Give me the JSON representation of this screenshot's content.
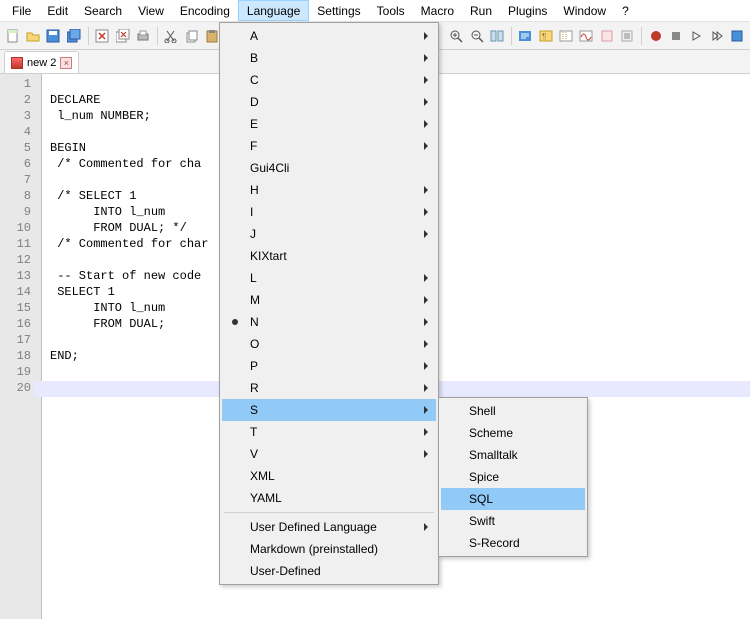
{
  "menubar": {
    "items": [
      "File",
      "Edit",
      "Search",
      "View",
      "Encoding",
      "Language",
      "Settings",
      "Tools",
      "Macro",
      "Run",
      "Plugins",
      "Window",
      "?"
    ],
    "active": "Language"
  },
  "tab": {
    "label": "new 2",
    "close": "×"
  },
  "gutter": {
    "lines": [
      "1",
      "2",
      "3",
      "4",
      "5",
      "6",
      "7",
      "8",
      "9",
      "10",
      "11",
      "12",
      "13",
      "14",
      "15",
      "16",
      "17",
      "18",
      "19",
      "20"
    ]
  },
  "code": {
    "lines": [
      "",
      "DECLARE",
      " l_num NUMBER;",
      "",
      "BEGIN",
      " /* Commented for cha",
      "",
      " /* SELECT 1",
      "      INTO l_num",
      "      FROM DUAL; */",
      " /* Commented for char",
      "",
      " -- Start of new code ",
      " SELECT 1",
      "      INTO l_num",
      "      FROM DUAL;",
      "",
      "END;",
      "",
      ""
    ]
  },
  "langMenu": {
    "groups": [
      {
        "items": [
          {
            "label": "A",
            "sub": true
          },
          {
            "label": "B",
            "sub": true
          },
          {
            "label": "C",
            "sub": true
          },
          {
            "label": "D",
            "sub": true
          },
          {
            "label": "E",
            "sub": true
          },
          {
            "label": "F",
            "sub": true
          },
          {
            "label": "Gui4Cli",
            "sub": false
          },
          {
            "label": "H",
            "sub": true
          },
          {
            "label": "I",
            "sub": true
          },
          {
            "label": "J",
            "sub": true
          },
          {
            "label": "KIXtart",
            "sub": false
          },
          {
            "label": "L",
            "sub": true
          },
          {
            "label": "M",
            "sub": true
          },
          {
            "label": "N",
            "sub": true,
            "bullet": true
          },
          {
            "label": "O",
            "sub": true
          },
          {
            "label": "P",
            "sub": true
          },
          {
            "label": "R",
            "sub": true
          },
          {
            "label": "S",
            "sub": true,
            "hover": true
          },
          {
            "label": "T",
            "sub": true
          },
          {
            "label": "V",
            "sub": true
          },
          {
            "label": "XML",
            "sub": false
          },
          {
            "label": "YAML",
            "sub": false
          }
        ]
      },
      {
        "items": [
          {
            "label": "User Defined Language",
            "sub": true
          },
          {
            "label": "Markdown (preinstalled)",
            "sub": false
          },
          {
            "label": "User-Defined",
            "sub": false
          }
        ]
      }
    ]
  },
  "subMenu": {
    "items": [
      {
        "label": "Shell"
      },
      {
        "label": "Scheme"
      },
      {
        "label": "Smalltalk"
      },
      {
        "label": "Spice"
      },
      {
        "label": "SQL",
        "hover": true
      },
      {
        "label": "Swift"
      },
      {
        "label": "S-Record"
      }
    ]
  }
}
